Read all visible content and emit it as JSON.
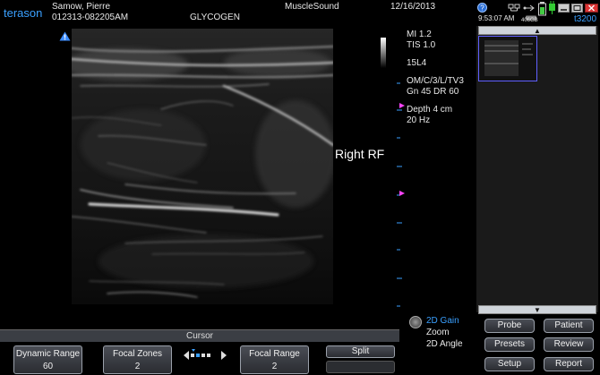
{
  "header": {
    "brand": "terason",
    "patient_name": "Samow, Pierre",
    "patient_id": "012313-082205AM",
    "study": "GLYCOGEN",
    "institution": "MuscleSound",
    "date": "12/16/2013",
    "time": "9:53:07 AM",
    "disk": "406GB",
    "model": "t3200"
  },
  "image": {
    "annotation": "Right RF"
  },
  "readout": {
    "mi": "MI  1.2",
    "tis": "TIS 1.0",
    "probe": "15L4",
    "preset": "OM/C/3/L/TV3",
    "gain_dr": "Gn 45   DR 60",
    "depth": "Depth 4 cm",
    "frame_rate": "20 Hz"
  },
  "bottom": {
    "cursor_label": "Cursor",
    "dynamic_range_label": "Dynamic Range",
    "dynamic_range_value": "60",
    "focal_zones_label": "Focal Zones",
    "focal_zones_value": "2",
    "focal_range_label": "Focal Range",
    "focal_range_value": "2",
    "split_label": "Split"
  },
  "knob_menu": {
    "gain": "2D Gain",
    "zoom": "Zoom",
    "angle": "2D Angle"
  },
  "right_buttons": {
    "probe": "Probe",
    "patient": "Patient",
    "presets": "Presets",
    "review": "Review",
    "setup": "Setup",
    "report": "Report"
  },
  "colors": {
    "brand": "#3aa0ff",
    "accent_blue": "#3aa0ff",
    "focal_marker": "#ff44ff"
  }
}
